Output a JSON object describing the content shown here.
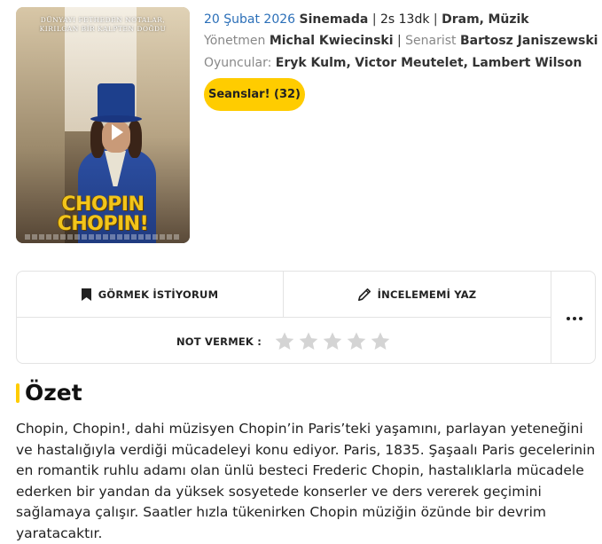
{
  "poster": {
    "tagline_line1": "DÜNYAYI FETHEDEN NOTALAR,",
    "tagline_line2": "KIRILGAN BİR KALPTEN DOĞDU",
    "title_line1": "CHOPIN",
    "title_line2": "CHOPIN!"
  },
  "movie": {
    "release_date": "20 Şubat 2026",
    "status": "Sinemada",
    "duration": "2s 13dk",
    "genres": [
      "Dram",
      "Müzik"
    ],
    "director_label": "Yönetmen",
    "director": "Michal Kwiecinski",
    "writer_label": "Senarist",
    "writer": "Bartosz Janiszewski",
    "cast_label": "Oyuncular:",
    "cast": [
      "Eryk Kulm",
      "Victor Meutelet",
      "Lambert Wilson"
    ],
    "showtimes_button": "Seanslar! (32)"
  },
  "actions": {
    "want_to_see": "GÖRMEK İSTİYORUM",
    "write_review": "İNCELEMEMİ YAZ",
    "rate_label": "NOT VERMEK :",
    "star_count": 5,
    "rating": 0
  },
  "summary": {
    "title": "Özet",
    "text": "Chopin, Chopin!, dahi müzisyen Chopin’in Paris’teki yaşamını, parlayan yeteneğini ve hastalığıyla verdiği mücadeleyi konu ediyor. Paris, 1835. Şaşaalı Paris gecelerinin en romantik ruhlu adamı olan ünlü besteci Frederic Chopin, hastalıklarla mücadele ederken bir yandan da yüksek sosyetede konserler ve ders vererek geçimini sağlamaya çalışır. Saatler hızla tükenirken Chopin müziğin özünde bir devrim yaratacaktır."
  },
  "colors": {
    "accent": "#ffcc00",
    "date_blue": "#2b6fb8",
    "star_empty": "#d4d4d4"
  }
}
